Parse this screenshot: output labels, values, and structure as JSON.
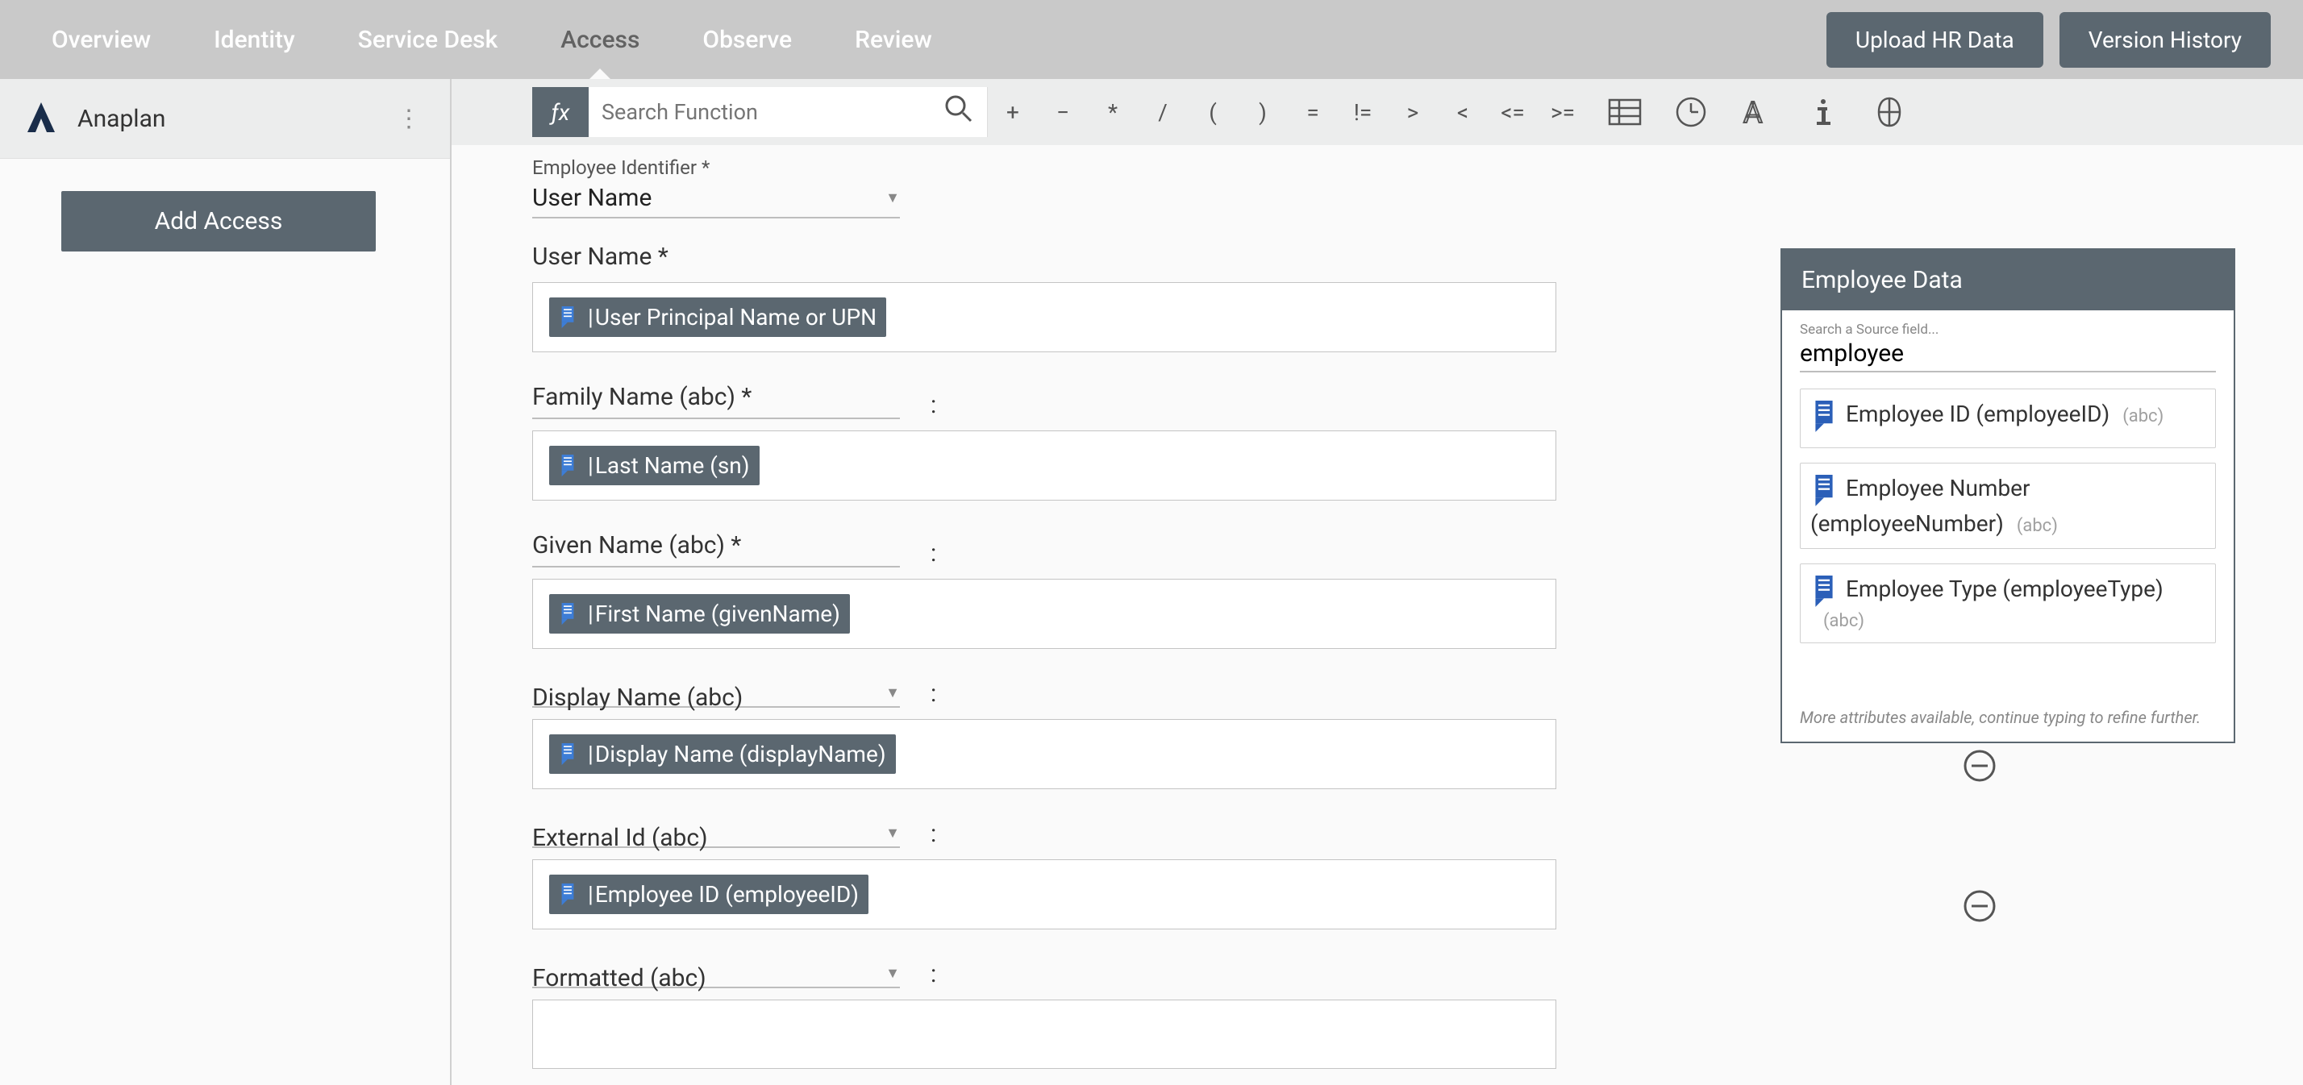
{
  "nav": {
    "tabs": [
      "Overview",
      "Identity",
      "Service Desk",
      "Access",
      "Observe",
      "Review"
    ],
    "active_index": 3,
    "upload_btn": "Upload HR Data",
    "version_btn": "Version History"
  },
  "left": {
    "item_name": "Anaplan",
    "add_btn": "Add Access"
  },
  "formula": {
    "fx": "ƒx",
    "search_placeholder": "Search Function",
    "ops": [
      "+",
      "−",
      "*",
      "/",
      "(",
      ")",
      "=",
      "!=",
      ">",
      "<",
      "<=",
      ">="
    ]
  },
  "form": {
    "identifier_label": "Employee Identifier",
    "identifier_value": "User Name",
    "fields": [
      {
        "label": "User Name *",
        "show_label_line": false,
        "colon": "",
        "token": "User Principal Name or UPN",
        "removable": false,
        "dropdown": false
      },
      {
        "label": "Family Name (abc) *",
        "show_label_line": true,
        "colon": ":",
        "token": "Last Name (sn)",
        "removable": false,
        "dropdown": false
      },
      {
        "label": "Given Name (abc) *",
        "show_label_line": true,
        "colon": ":",
        "token": "First Name (givenName)",
        "removable": false,
        "dropdown": false
      },
      {
        "label": "Display Name (abc)",
        "show_label_line": true,
        "colon": ":",
        "token": "Display Name (displayName)",
        "removable": true,
        "dropdown": true
      },
      {
        "label": "External Id (abc)",
        "show_label_line": true,
        "colon": ":",
        "token": "Employee ID (employeeID)",
        "removable": true,
        "dropdown": true
      },
      {
        "label": "Formatted (abc)",
        "show_label_line": true,
        "colon": ":",
        "token": "",
        "removable": false,
        "dropdown": true
      }
    ]
  },
  "panel": {
    "title": "Employee Data",
    "search_hint": "Search a Source field...",
    "search_value": "employee",
    "results": [
      {
        "name": "Employee ID (employeeID)",
        "type": "(abc)"
      },
      {
        "name": "Employee Number (employeeNumber)",
        "type": "(abc)"
      },
      {
        "name": "Employee Type (employeeType)",
        "type": "(abc)"
      }
    ],
    "note": "More attributes available, continue typing to refine further."
  }
}
